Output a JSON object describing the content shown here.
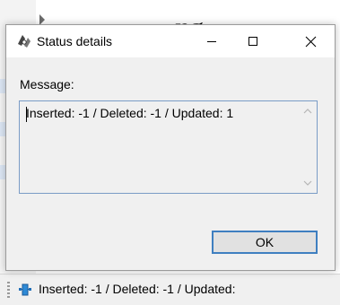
{
  "background": {
    "heading_fragment": "ng",
    "side_fragments": [
      "o",
      "oi"
    ]
  },
  "dialog": {
    "title": "Status details",
    "message_label": "Message:",
    "message": "Inserted: -1 / Deleted: -1 / Updated: 1",
    "ok_label": "OK"
  },
  "statusbar": {
    "text": "Inserted: -1 / Deleted: -1 / Updated:"
  },
  "colors": {
    "accent": "#3f7fc0",
    "textbox_border": "#7a9cc6"
  }
}
